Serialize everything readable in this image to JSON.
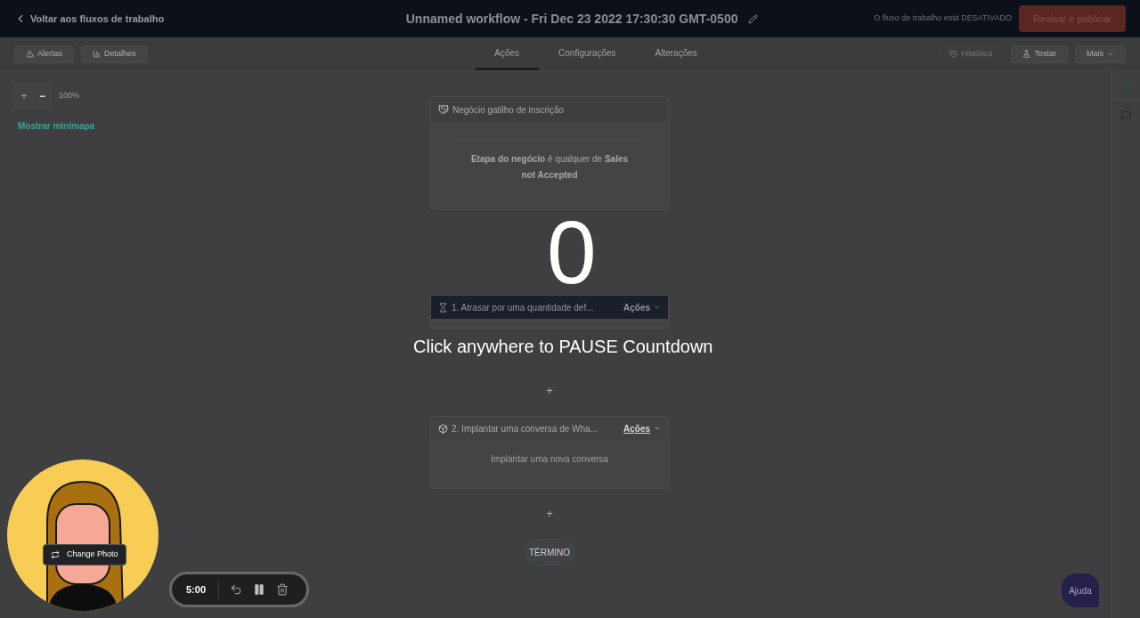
{
  "header": {
    "back_link": "Voltar aos fluxos de trabalho",
    "title": "Unnamed workflow - Fri Dec 23 2022 17:30:30 GMT-0500",
    "status": "O fluxo de trabalho está DESATIVADO",
    "publish_button": "Revisar e publicar"
  },
  "toolbar": {
    "left_buttons": [
      {
        "kind": "alert",
        "label": "Alertas"
      },
      {
        "kind": "chart",
        "label": "Detalhes"
      }
    ],
    "tabs": [
      {
        "label": "Ações",
        "selected": true
      },
      {
        "label": "Configurações",
        "selected": false
      },
      {
        "label": "Alterações",
        "selected": false
      }
    ],
    "right_buttons": [
      {
        "kind": "history",
        "label": "Histórico",
        "disabled": true
      },
      {
        "kind": "test",
        "label": "Testar",
        "disabled": false
      },
      {
        "kind": "more",
        "label": "Mais",
        "disabled": false
      }
    ]
  },
  "zoom": {
    "plus": "+",
    "minus": "−",
    "level": "100%",
    "minimap_link": "Mostrar minimapa"
  },
  "trigger": {
    "title": "Negócio gatilho de inscrição",
    "condition": "**Etapa do negócio** é qualquer de **Sales not Accepted**"
  },
  "steps": [
    {
      "kind": "delay",
      "title": "1. Atrasar por uma quantidade def...",
      "menu": "Ações",
      "active": true
    },
    {
      "kind": "deploy",
      "title": "2. Implantar uma conversa de Wha...",
      "menu": "Ações",
      "active": false,
      "body": "Implantar uma nova conversa"
    }
  ],
  "add_buttons": [
    "+",
    "+"
  ],
  "end_node": "TÉRMINO",
  "help_button": "Ajuda",
  "countdown": {
    "number": "0",
    "hint": "Click anywhere to PAUSE Countdown"
  },
  "recorder": {
    "change_photo": "Change Photo",
    "time": "5:00"
  }
}
